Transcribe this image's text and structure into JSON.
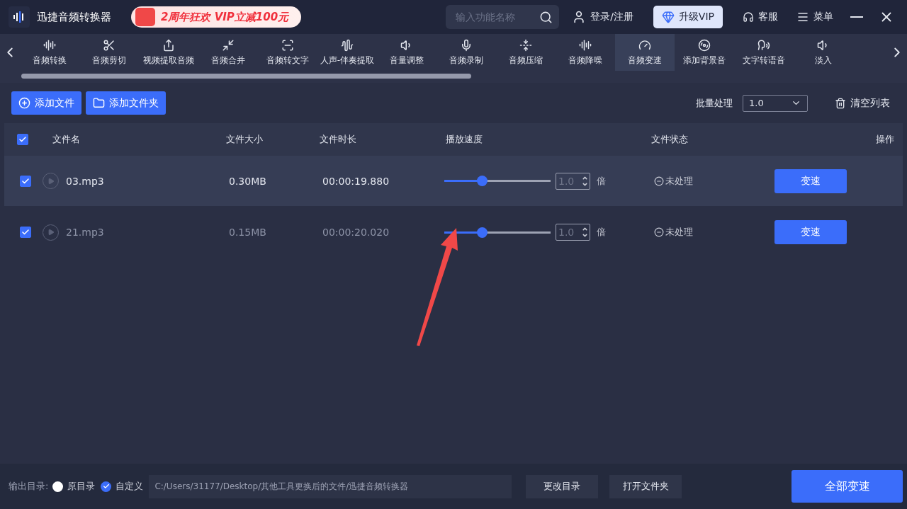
{
  "app": {
    "title": "迅捷音频转换器",
    "promo": "2周年狂欢 VIP立减100元",
    "search_placeholder": "输入功能名称",
    "login": "登录/注册",
    "vip": "升级VIP",
    "service": "客服",
    "menu": "菜单"
  },
  "tools": [
    {
      "label": "音频转换",
      "selected": false
    },
    {
      "label": "音频剪切",
      "selected": false
    },
    {
      "label": "视频提取音频",
      "selected": false
    },
    {
      "label": "音频合并",
      "selected": false
    },
    {
      "label": "音频转文字",
      "selected": false
    },
    {
      "label": "人声-伴奏提取",
      "selected": false
    },
    {
      "label": "音量调整",
      "selected": false
    },
    {
      "label": "音频录制",
      "selected": false
    },
    {
      "label": "音频压缩",
      "selected": false
    },
    {
      "label": "音频降噪",
      "selected": false
    },
    {
      "label": "音频变速",
      "selected": true
    },
    {
      "label": "添加背景音",
      "selected": false
    },
    {
      "label": "文字转语音",
      "selected": false
    },
    {
      "label": "淡入",
      "selected": false
    }
  ],
  "actions": {
    "add_file": "添加文件",
    "add_folder": "添加文件夹",
    "batch_label": "批量处理",
    "batch_value": "1.0",
    "clear": "清空列表"
  },
  "table": {
    "all_checked": true,
    "columns": [
      "文件名",
      "文件大小",
      "文件时长",
      "播放速度",
      "文件状态",
      "操作"
    ],
    "rows": [
      {
        "checked": true,
        "selected": true,
        "name": "03.mp3",
        "size": "0.30MB",
        "duration": "00:00:19.880",
        "level": 0.35,
        "speed": "1.0",
        "unit": "倍",
        "status": "未处理",
        "action": "变速"
      },
      {
        "checked": true,
        "selected": false,
        "name": "21.mp3",
        "size": "0.15MB",
        "duration": "00:00:20.020",
        "level": 0.35,
        "speed": "1.0",
        "unit": "倍",
        "status": "未处理",
        "action": "变速"
      }
    ]
  },
  "footer": {
    "label": "输出目录:",
    "options": [
      {
        "label": "原目录",
        "selected": false
      },
      {
        "label": "自定义",
        "selected": true
      }
    ],
    "path": "C:/Users/31177/Desktop/其他工具更换后的文件/迅捷音频转换器",
    "change": "更改目录",
    "open": "打开文件夹",
    "run_all": "全部变速"
  }
}
